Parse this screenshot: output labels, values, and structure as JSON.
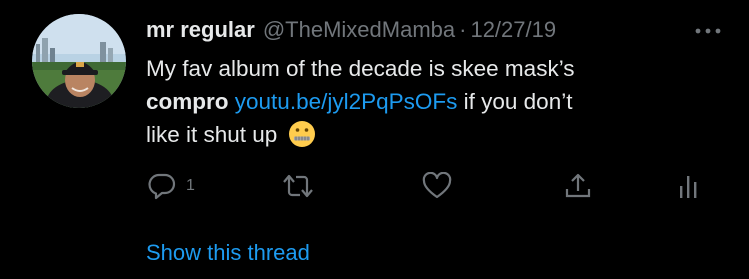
{
  "tweet": {
    "display_name": "mr regular",
    "handle": "@TheMixedMamba",
    "separator": "·",
    "date": "12/27/19",
    "text_line1": "My fav album of the decade is skee mask’s",
    "bold_text": "compro",
    "link_text": "youtu.be/jyl2PqPsOFs",
    "text_after_link": " if you don’t",
    "text_line3": "like it shut up",
    "emoji": "zipper-mouth-face"
  },
  "actions": {
    "reply_count": "1",
    "icons": [
      "reply-icon",
      "retweet-icon",
      "like-icon",
      "share-icon",
      "analytics-icon"
    ]
  },
  "thread": {
    "show_label": "Show this thread"
  },
  "colors": {
    "background": "#000000",
    "text": "#e7e9ea",
    "muted": "#71767b",
    "link": "#1d9bf0"
  }
}
